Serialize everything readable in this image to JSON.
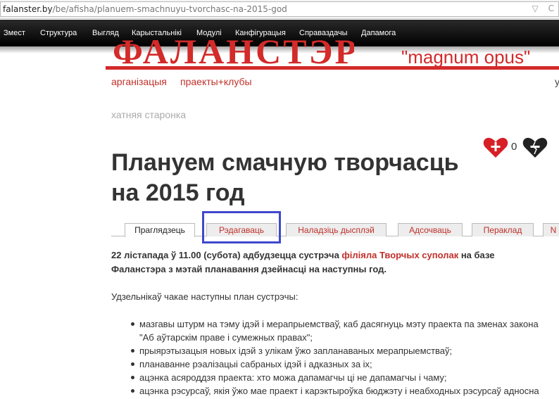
{
  "browser": {
    "url_host": "falanster.by",
    "url_path": "/be/afisha/planuem-smachnuyu-tvorchasc-na-2015-god",
    "icons": [
      "dropdown-icon",
      "refresh-icon"
    ]
  },
  "toolbar": {
    "items": [
      "Змест",
      "Структура",
      "Выгляд",
      "Карыстальнікі",
      "Модулі",
      "Канфігурацыя",
      "Справаздачы",
      "Дапамога"
    ]
  },
  "header": {
    "logo_text": "ФАЛАНСТЭР",
    "motto": "\"magnum opus\"",
    "nav": [
      "арганізацыя",
      "праекты+клубы"
    ],
    "nav_right": "у"
  },
  "breadcrumb": "хатняя старонка",
  "page": {
    "title": "Плануем смачную творчасць на 2015 год"
  },
  "likes": {
    "count": "0"
  },
  "tabs": [
    "Праглядзець",
    "Рэдагаваць",
    "Наладзіць дысплэй",
    "Адсочваць",
    "Пераклад",
    "N"
  ],
  "content": {
    "lead_part1": "22 лістапада ў 11.00 (субота) адбудзецца сустрэча ",
    "lead_link": "філіяла Творчых суполак",
    "lead_part2": " на базе Фаланстэра з мэтай планавання дзейнасці на наступны год.",
    "intro": "Удзельнікаў чакае наступны план сустрэчы:",
    "items": [
      "мазгавы штурм на тэму ідэй і мерапрыемстваў, каб дасягнуць мэту праекта па зменах закона",
      "\"Аб аўтарскім праве і сумежных правах\";",
      "прыярэтызацыя новых ідэй з улікам ўжо запланаваных мерапрыемстваў;",
      "планаванне рэалізацыі сабраных ідэй і адказных за іх;",
      "ацэнка асяроддзя праекта: хто можа дапамагчы ці не дапамагчы і чаму;",
      "ацэнка рэсурсаў, якія ўжо мае праект і карэктыроўка бюджэту і неабходных рэсурсаў адносна"
    ]
  },
  "colors": {
    "brand_red": "#d32a2a",
    "link_red": "#c0302b",
    "highlight_blue": "#3f48cc"
  }
}
